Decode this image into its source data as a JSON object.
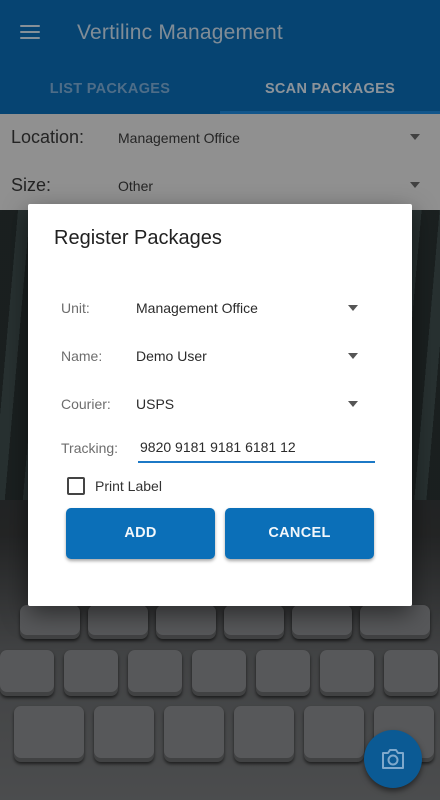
{
  "app": {
    "title": "Vertilinc Management",
    "menu_icon": "hamburger-menu-icon",
    "brand_color": "#0b6fb8"
  },
  "tabs": [
    {
      "label": "LIST PACKAGES",
      "active": false
    },
    {
      "label": "SCAN PACKAGES",
      "active": true
    }
  ],
  "form": {
    "location_label": "Location:",
    "location_value": "Management Office",
    "size_label": "Size:",
    "size_value": "Other"
  },
  "dialog": {
    "title": "Register Packages",
    "unit_label": "Unit:",
    "unit_value": "Management Office",
    "name_label": "Name:",
    "name_value": "Demo User",
    "courier_label": "Courier:",
    "courier_value": "USPS",
    "tracking_label": "Tracking:",
    "tracking_value": "9820 9181 9181 6181 12",
    "print_label": "Print Label",
    "print_checked": false,
    "add_label": "ADD",
    "cancel_label": "CANCEL"
  },
  "fab": {
    "icon": "camera-icon"
  }
}
